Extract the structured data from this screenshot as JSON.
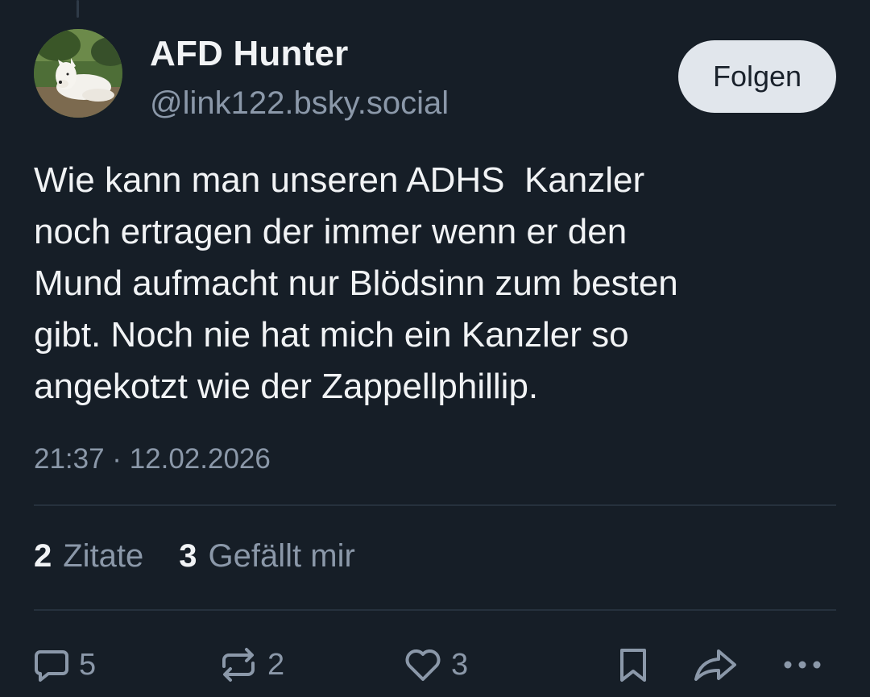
{
  "author": {
    "name": "AFD Hunter",
    "handle": "@link122.bsky.social",
    "avatar": "white-dog-avatar"
  },
  "follow_button": {
    "label": "Folgen"
  },
  "post": {
    "text": "Wie kann man unseren ADHS  Kanzler\nnoch ertragen der immer wenn er den\nMund aufmacht nur Blödsinn zum besten\ngibt. Noch nie hat mich ein Kanzler so\nangekotzt wie der Zappellphillip.",
    "timestamp": "21:37 · 12.02.2026"
  },
  "stats": [
    {
      "count": "2",
      "label": "Zitate"
    },
    {
      "count": "3",
      "label": "Gefällt mir"
    }
  ],
  "actions": {
    "reply": {
      "icon": "reply-icon",
      "count": "5"
    },
    "repost": {
      "icon": "repost-icon",
      "count": "2"
    },
    "like": {
      "icon": "heart-icon",
      "count": "3"
    },
    "bookmark": {
      "icon": "bookmark-icon"
    },
    "share": {
      "icon": "share-icon"
    },
    "more": {
      "icon": "more-icon"
    }
  },
  "colors": {
    "background": "#161e27",
    "text_primary": "#f1f3f5",
    "text_secondary": "#8b98a9",
    "button_bg": "#e1e6ec",
    "divider": "#26313d"
  }
}
